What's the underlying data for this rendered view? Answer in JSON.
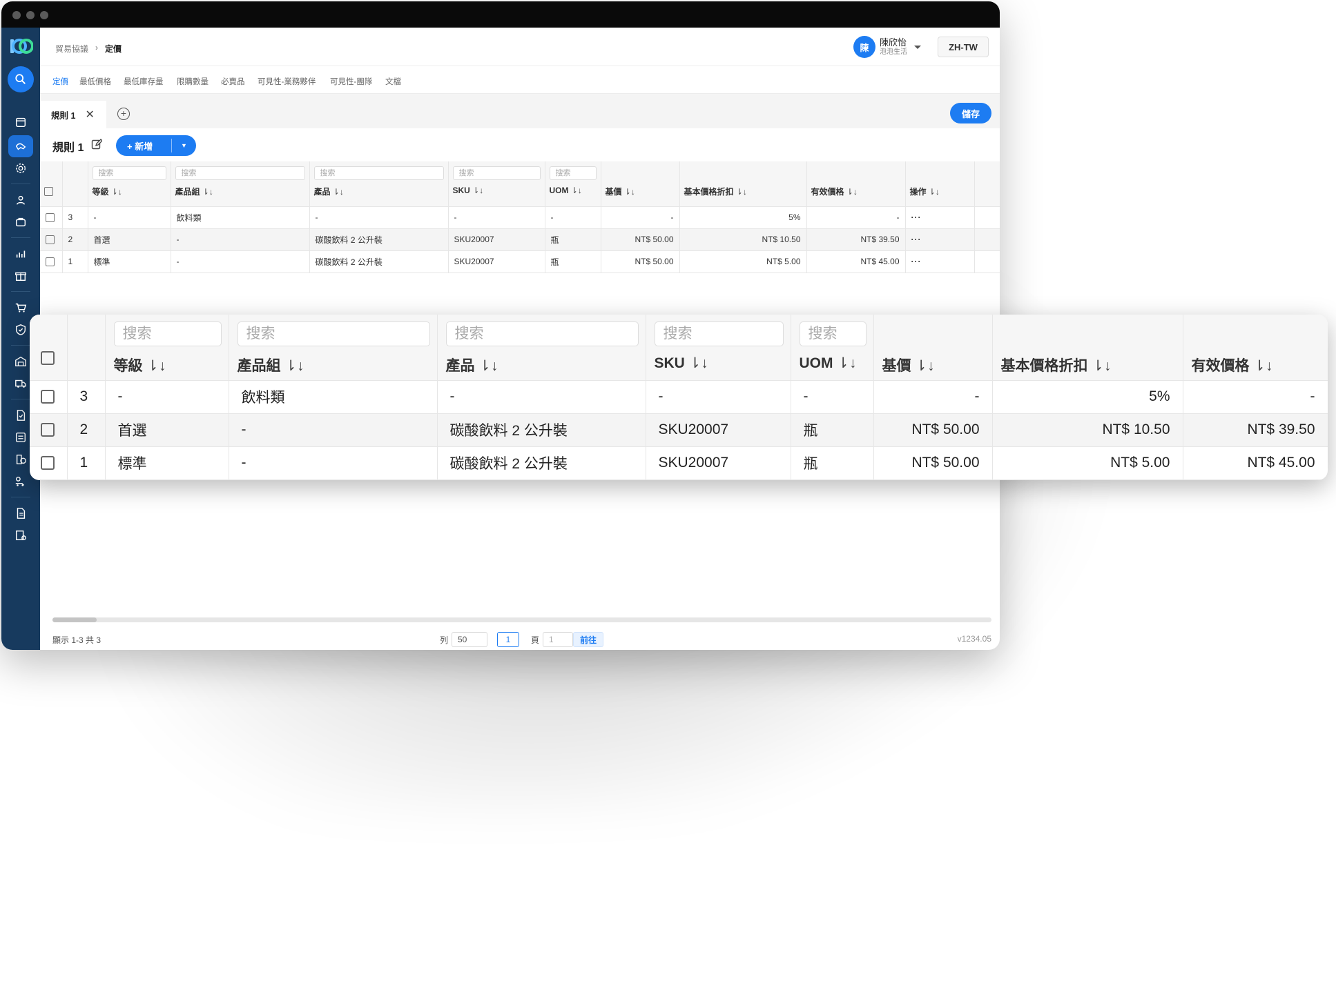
{
  "breadcrumb": {
    "parent": "貿易協議",
    "current": "定價"
  },
  "user": {
    "avatar": "陳",
    "name": "陳欣怡",
    "company": "泡泡生活"
  },
  "language": "ZH-TW",
  "tabs": [
    "定價",
    "最低價格",
    "最低庫存量",
    "限購數量",
    "必賣品",
    "可見性-業務夥伴",
    "可見性-團隊",
    "文檔"
  ],
  "rule_tab": {
    "label": "規則 1"
  },
  "save_label": "儲存",
  "rule_title": "規則 1",
  "add_label": "+ 新增",
  "table": {
    "search_placeholder": "搜索",
    "sort_icon": "⇂↓",
    "headers": {
      "grade": "等級",
      "product_group": "產品組",
      "product": "產品",
      "sku": "SKU",
      "uom": "UOM",
      "base_price": "基價",
      "discount": "基本價格折扣",
      "effective_price": "有效價格",
      "actions": "操作"
    },
    "rows": [
      {
        "index": "3",
        "grade": "-",
        "product_group": "飲料類",
        "product": "-",
        "sku": "-",
        "uom": "-",
        "base_price": "-",
        "discount": "5%",
        "effective_price": "-",
        "actions": "···"
      },
      {
        "index": "2",
        "grade": "首選",
        "product_group": "-",
        "product": "碳酸飲料 2 公升裝",
        "sku": "SKU20007",
        "uom": "瓶",
        "base_price": "NT$ 50.00",
        "discount": "NT$ 10.50",
        "effective_price": "NT$ 39.50",
        "actions": "···"
      },
      {
        "index": "1",
        "grade": "標準",
        "product_group": "-",
        "product": "碳酸飲料 2 公升裝",
        "sku": "SKU20007",
        "uom": "瓶",
        "base_price": "NT$ 50.00",
        "discount": "NT$ 5.00",
        "effective_price": "NT$ 45.00",
        "actions": "···"
      }
    ]
  },
  "footer": {
    "summary": "顯示 1-3 共 3",
    "rows_label": "列",
    "rows_value": "50",
    "page_current": "1",
    "page_label": "頁",
    "goto_value": "1",
    "goto_label": "前往",
    "version": "v1234.05"
  },
  "colors": {
    "accent": "#1d7cf2",
    "sidebar": "#173a5e"
  }
}
